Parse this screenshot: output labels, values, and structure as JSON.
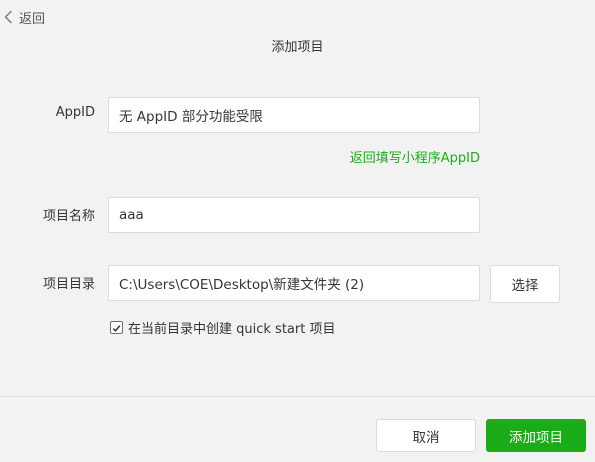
{
  "header": {
    "back_label": "返回",
    "title": "添加项目"
  },
  "form": {
    "appid": {
      "label": "AppID",
      "value": "无 AppID 部分功能受限",
      "hint_link": "返回填写小程序AppID"
    },
    "project_name": {
      "label": "项目名称",
      "value": "aaa"
    },
    "project_dir": {
      "label": "项目目录",
      "value": "C:\\Users\\COE\\Desktop\\新建文件夹 (2)",
      "choose_label": "选择"
    },
    "quickstart": {
      "checked": true,
      "label": "在当前目录中创建 quick start 项目"
    }
  },
  "footer": {
    "cancel_label": "取消",
    "submit_label": "添加项目"
  },
  "colors": {
    "accent": "#1aad19",
    "background": "#f2f2f2"
  },
  "icons": {
    "back": "chevron-left-icon",
    "checkbox": "checkmark-icon"
  }
}
